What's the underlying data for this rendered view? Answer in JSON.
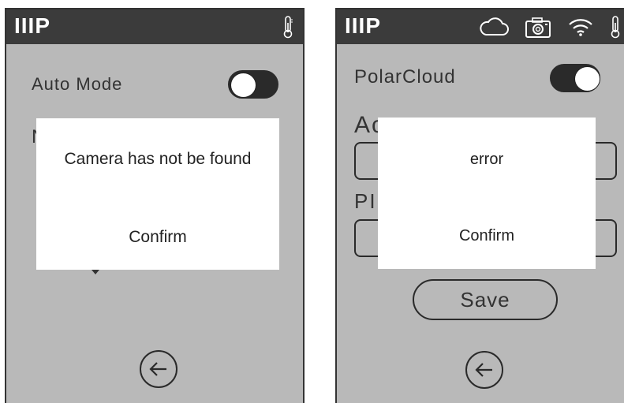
{
  "left_screen": {
    "logo": "IIIP",
    "topbar_icons": [
      "thermometer-icon"
    ],
    "auto_mode_label": "Auto Mode",
    "auto_mode_toggle": "off",
    "partial_label": "N",
    "dialog": {
      "message": "Camera has not be found",
      "confirm_label": "Confirm"
    },
    "back_icon": "back-arrow-icon"
  },
  "right_screen": {
    "logo": "IIIP",
    "topbar_icons": [
      "cloud-icon",
      "camera-icon",
      "wifi-icon",
      "thermometer-icon"
    ],
    "polarcloud_label": "PolarCloud",
    "polarcloud_toggle": "on",
    "partial_label_1": "Ac",
    "partial_label_2": "PI",
    "save_label": "Save",
    "dialog": {
      "message": "error",
      "confirm_label": "Confirm"
    },
    "back_icon": "back-arrow-icon"
  },
  "colors": {
    "screen_bg": "#b9b9b9",
    "topbar_bg": "#3b3b3b",
    "toggle_bg": "#2a2a2a",
    "dialog_bg": "#ffffff"
  }
}
